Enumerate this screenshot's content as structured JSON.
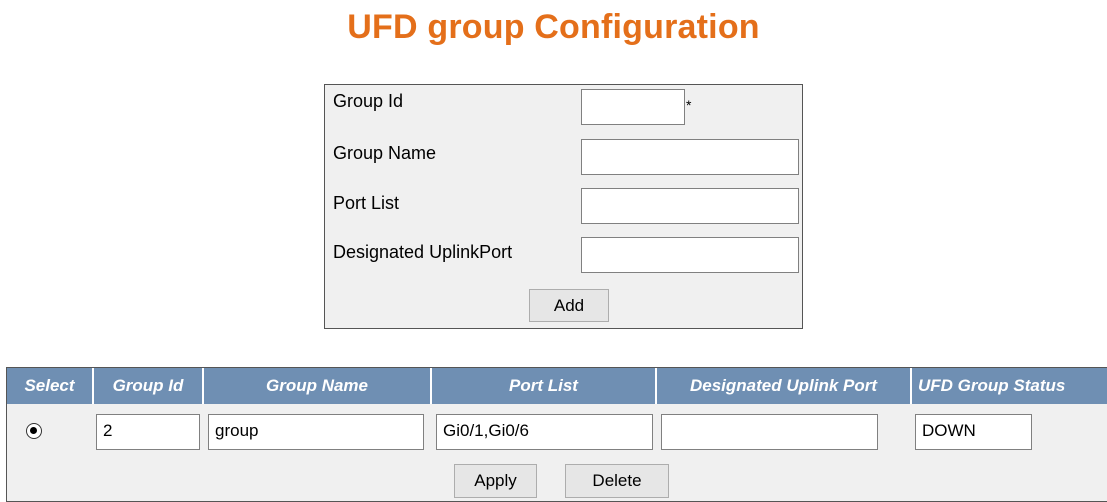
{
  "page": {
    "title": "UFD group Configuration"
  },
  "form": {
    "group_id_label": "Group Id",
    "group_id_value": "",
    "required_marker": "*",
    "group_name_label": "Group Name",
    "group_name_value": "",
    "port_list_label": "Port List",
    "port_list_value": "",
    "uplink_label": "Designated UplinkPort",
    "uplink_value": "",
    "add_label": "Add"
  },
  "table": {
    "headers": [
      "Select",
      "Group Id",
      "Group Name",
      "Port List",
      "Designated Uplink Port",
      "UFD Group Status"
    ],
    "rows": [
      {
        "selected": true,
        "group_id": "2",
        "group_name": "group",
        "port_list": "Gi0/1,Gi0/6",
        "uplink_port": "",
        "status": "DOWN"
      }
    ],
    "apply_label": "Apply",
    "delete_label": "Delete"
  },
  "colors": {
    "title": "#e46f1a",
    "header_bg": "#6f8fb3",
    "panel_bg": "#f0f0f0"
  }
}
